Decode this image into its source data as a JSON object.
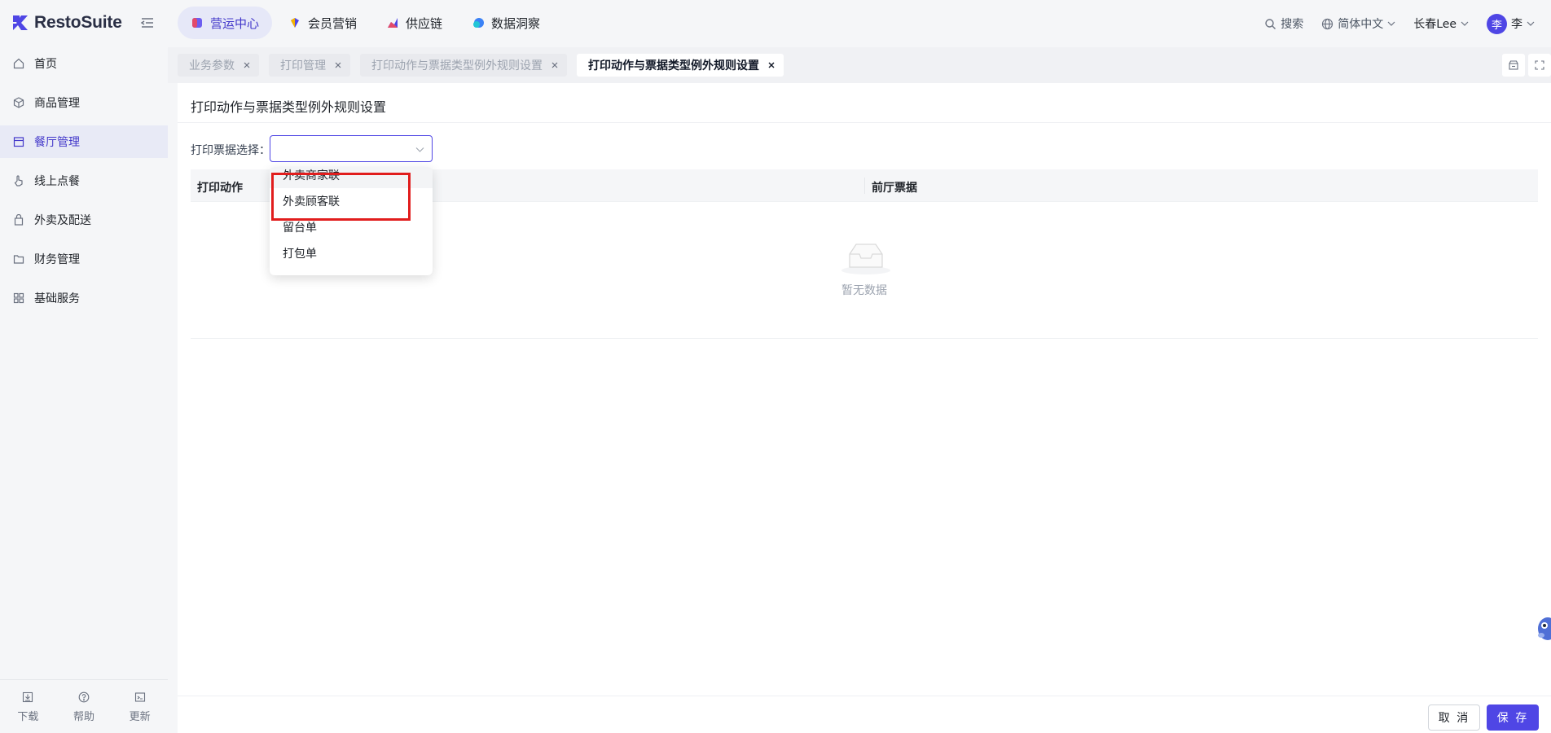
{
  "app": {
    "name": "RestoSuite"
  },
  "topnav": [
    {
      "label": "营运中心",
      "icon": "cube-icon",
      "active": true
    },
    {
      "label": "会员营销",
      "icon": "gem-icon",
      "active": false
    },
    {
      "label": "供应链",
      "icon": "chart-icon",
      "active": false
    },
    {
      "label": "数据洞察",
      "icon": "sphere-icon",
      "active": false
    }
  ],
  "topright": {
    "search": "搜索",
    "language": "简体中文",
    "store": "长春Lee",
    "avatar_char": "李",
    "user": "李"
  },
  "sidebar": {
    "items": [
      {
        "label": "首页",
        "icon": "home-icon"
      },
      {
        "label": "商品管理",
        "icon": "box-icon"
      },
      {
        "label": "餐厅管理",
        "icon": "store-icon",
        "active": true
      },
      {
        "label": "线上点餐",
        "icon": "hand-pointer-icon"
      },
      {
        "label": "外卖及配送",
        "icon": "bag-icon"
      },
      {
        "label": "财务管理",
        "icon": "folder-icon"
      },
      {
        "label": "基础服务",
        "icon": "grid-icon"
      }
    ],
    "bottom": [
      {
        "label": "下载",
        "icon": "download-icon"
      },
      {
        "label": "帮助",
        "icon": "help-icon"
      },
      {
        "label": "更新",
        "icon": "update-icon"
      }
    ]
  },
  "tabs": [
    {
      "label": "业务参数",
      "active": false
    },
    {
      "label": "打印管理",
      "active": false
    },
    {
      "label": "打印动作与票据类型例外规则设置",
      "active": false
    },
    {
      "label": "打印动作与票据类型例外规则设置",
      "active": true
    }
  ],
  "page": {
    "title": "打印动作与票据类型例外规则设置",
    "filter_label": "打印票据选择：",
    "select_value": ""
  },
  "table": {
    "columns": [
      "打印动作",
      "前厅票据"
    ],
    "empty_text": "暂无数据"
  },
  "dropdown": {
    "options": [
      "外卖商家联",
      "外卖顾客联",
      "留台单",
      "打包单"
    ]
  },
  "footer": {
    "cancel": "取 消",
    "save": "保 存"
  },
  "colors": {
    "accent": "#4f46e5",
    "highlight": "#e11d1d"
  }
}
